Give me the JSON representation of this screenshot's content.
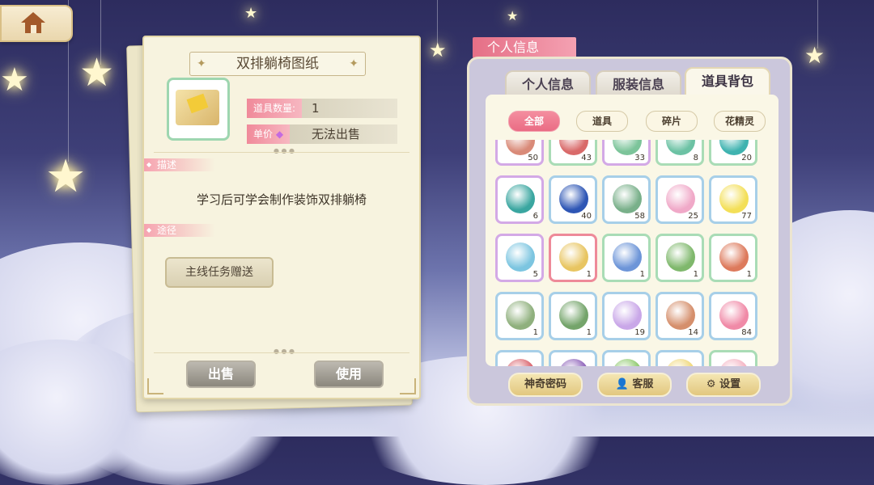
{
  "item_card": {
    "title": "双排躺椅图纸",
    "quantity_label": "道具数量:",
    "quantity_value": "1",
    "price_label": "单价",
    "price_value": "无法出售",
    "desc_label": "描述",
    "description": "学习后可学会制作装饰双排躺椅",
    "source_label": "途径",
    "source_value": "主线任务赠送",
    "sell_button": "出售",
    "use_button": "使用"
  },
  "panel": {
    "ribbon": "个人信息",
    "tabs": [
      "个人信息",
      "服装信息",
      "道具背包"
    ],
    "active_tab": 2,
    "filters": [
      "全部",
      "道具",
      "碎片",
      "花精灵"
    ],
    "active_filter": 0,
    "items": [
      {
        "count": "50",
        "border": "purple",
        "icon": "red-scroll-icon",
        "color": "#d98a78"
      },
      {
        "count": "43",
        "border": "green",
        "icon": "red-gift-icon",
        "color": "#d96a6a"
      },
      {
        "count": "33",
        "border": "purple",
        "icon": "green-ring-icon",
        "color": "#7cc49a"
      },
      {
        "count": "8",
        "border": "green",
        "icon": "jade-box-icon",
        "color": "#6cc2a4"
      },
      {
        "count": "20",
        "border": "green",
        "icon": "teal-gem-icon",
        "color": "#3fb3b0"
      },
      {
        "count": "6",
        "border": "purple",
        "icon": "teal-orb-icon",
        "color": "#3aa6a0"
      },
      {
        "count": "40",
        "border": "blue",
        "icon": "blue-potion-icon",
        "color": "#2e56b5"
      },
      {
        "count": "58",
        "border": "blue",
        "icon": "leaf-icon",
        "color": "#79b08a"
      },
      {
        "count": "25",
        "border": "blue",
        "icon": "pink-lotus-icon",
        "color": "#f0a9c8"
      },
      {
        "count": "77",
        "border": "blue",
        "icon": "star-icon",
        "color": "#f3df58"
      },
      {
        "count": "5",
        "border": "purple",
        "icon": "pond-icon",
        "color": "#7cc5e0"
      },
      {
        "count": "1",
        "border": "sel",
        "icon": "gold-blueprint-icon",
        "color": "#e8c561"
      },
      {
        "count": "1",
        "border": "green",
        "icon": "blue-blueprint-icon",
        "color": "#6d95d8"
      },
      {
        "count": "1",
        "border": "green",
        "icon": "green-blueprint-icon",
        "color": "#7fb86c"
      },
      {
        "count": "1",
        "border": "green",
        "icon": "flower-blueprint-icon",
        "color": "#dd7a5c"
      },
      {
        "count": "1",
        "border": "blue",
        "icon": "fence-blueprint-icon",
        "color": "#8fb07d"
      },
      {
        "count": "1",
        "border": "blue",
        "icon": "wreath-blueprint-icon",
        "color": "#74a46a"
      },
      {
        "count": "19",
        "border": "blue",
        "icon": "purple-egg-icon",
        "color": "#c9a7e8"
      },
      {
        "count": "14",
        "border": "blue",
        "icon": "brown-seed-icon",
        "color": "#d58f6c"
      },
      {
        "count": "84",
        "border": "blue",
        "icon": "pink-seed-icon",
        "color": "#f08aa7"
      },
      {
        "count": "",
        "border": "blue",
        "icon": "red-seed-icon",
        "color": "#d9606a"
      },
      {
        "count": "",
        "border": "blue",
        "icon": "grape-icon",
        "color": "#8b5fb8"
      },
      {
        "count": "",
        "border": "blue",
        "icon": "green-seed-icon",
        "color": "#8cc86a"
      },
      {
        "count": "",
        "border": "blue",
        "icon": "yellow-seed-icon",
        "color": "#f0d878"
      },
      {
        "count": "",
        "border": "green",
        "icon": "pink-bud-icon",
        "color": "#f4b2c2"
      }
    ],
    "buttons": [
      "神奇密码",
      "客服",
      "设置"
    ]
  }
}
